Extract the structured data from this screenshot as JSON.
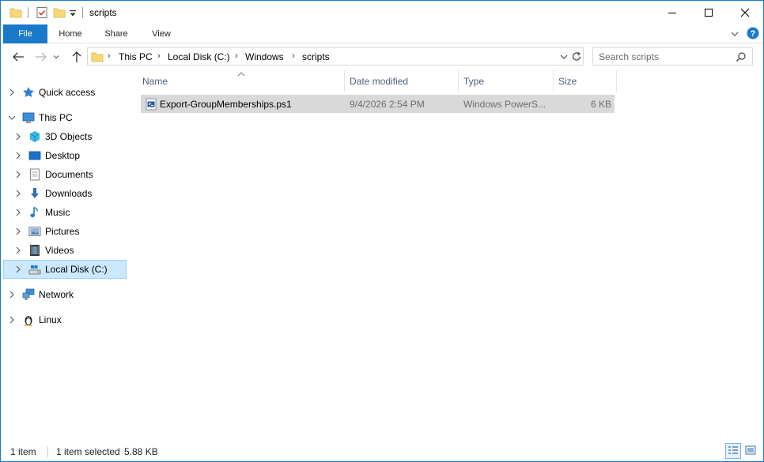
{
  "window": {
    "title": "scripts",
    "controls": {
      "minimize": "minimize",
      "maximize": "maximize",
      "close": "close"
    }
  },
  "ribbon": {
    "tabs": [
      {
        "label": "File"
      },
      {
        "label": "Home"
      },
      {
        "label": "Share"
      },
      {
        "label": "View"
      }
    ]
  },
  "address": {
    "breadcrumbs": [
      "This PC",
      "Local Disk (C:)",
      "Windows",
      "scripts"
    ]
  },
  "search": {
    "placeholder": "Search scripts",
    "value": ""
  },
  "navigation": {
    "items": [
      {
        "label": "Quick access",
        "icon": "star-icon",
        "level": 0
      },
      {
        "label": "This PC",
        "icon": "computer-icon",
        "level": 0,
        "expanded": true
      },
      {
        "label": "3D Objects",
        "icon": "cube-icon",
        "level": 1
      },
      {
        "label": "Desktop",
        "icon": "desktop-icon",
        "level": 1
      },
      {
        "label": "Documents",
        "icon": "document-icon",
        "level": 1
      },
      {
        "label": "Downloads",
        "icon": "download-icon",
        "level": 1
      },
      {
        "label": "Music",
        "icon": "music-icon",
        "level": 1
      },
      {
        "label": "Pictures",
        "icon": "picture-icon",
        "level": 1
      },
      {
        "label": "Videos",
        "icon": "video-icon",
        "level": 1
      },
      {
        "label": "Local Disk (C:)",
        "icon": "drive-icon",
        "level": 1,
        "selected": true
      },
      {
        "label": "Network",
        "icon": "network-icon",
        "level": 0
      },
      {
        "label": "Linux",
        "icon": "linux-icon",
        "level": 0
      }
    ]
  },
  "columns": {
    "name": "Name",
    "date_modified": "Date modified",
    "type": "Type",
    "size": "Size"
  },
  "files": [
    {
      "name": "Export-GroupMemberships.ps1",
      "date_modified": "9/4/2026 2:54 PM",
      "type": "Windows PowerS...",
      "size": "6 KB",
      "icon": "powershell-file-icon",
      "selected": true
    }
  ],
  "status": {
    "item_count": "1 item",
    "selection": "1 item selected",
    "selection_size": "5.88 KB"
  },
  "colors": {
    "accent": "#1979ca",
    "selection_bg": "#cce8ff",
    "row_selected_bg": "#d9d9d9",
    "header_text": "#4c607a"
  }
}
